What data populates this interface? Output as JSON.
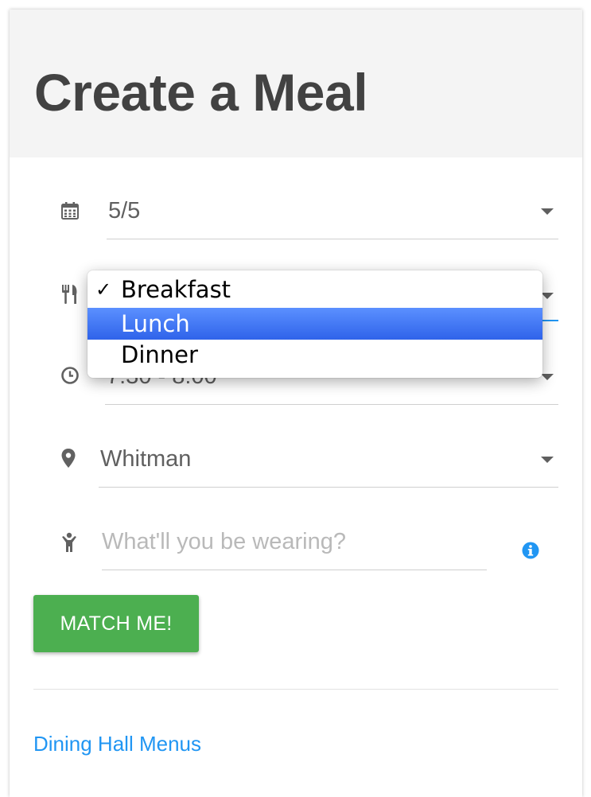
{
  "page": {
    "title": "Create a Meal"
  },
  "form": {
    "date": {
      "icon": "calendar-icon",
      "value": "5/5"
    },
    "meal": {
      "icon": "utensils-icon",
      "options": [
        {
          "label": "Breakfast",
          "checked": true,
          "highlighted": false
        },
        {
          "label": "Lunch",
          "checked": false,
          "highlighted": true
        },
        {
          "label": "Dinner",
          "checked": false,
          "highlighted": false
        }
      ],
      "check_mark": "✓"
    },
    "time": {
      "icon": "clock-icon",
      "value": "7:30 - 8:00"
    },
    "location": {
      "icon": "location-pin-icon",
      "value": "Whitman"
    },
    "outfit": {
      "icon": "person-icon",
      "placeholder": "What'll you be wearing?",
      "info_icon": "info-icon"
    },
    "submit_label": "MATCH ME!"
  },
  "footer": {
    "link_label": "Dining Hall Menus"
  },
  "colors": {
    "accent_blue": "#2196f3",
    "button_green": "#4caf50",
    "header_bg": "#f4f4f4",
    "highlight_blue": "#3b73f2"
  }
}
